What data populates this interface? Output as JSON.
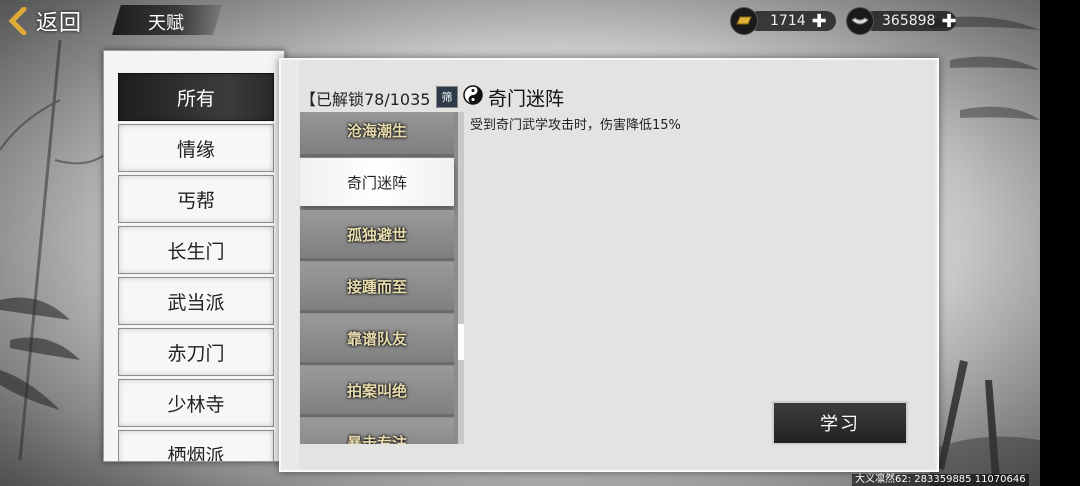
{
  "header": {
    "back_label": "返回",
    "page_title": "天赋",
    "gold": {
      "value": "1714",
      "icon": "gold-ingot-icon"
    },
    "silver": {
      "value": "365898",
      "icon": "silver-ingot-icon"
    }
  },
  "categories": [
    {
      "label": "所有",
      "active": true
    },
    {
      "label": "情缘"
    },
    {
      "label": "丐帮"
    },
    {
      "label": "长生门"
    },
    {
      "label": "武当派"
    },
    {
      "label": "赤刀门"
    },
    {
      "label": "少林寺"
    },
    {
      "label": "栖烟派"
    }
  ],
  "talents": {
    "unlock_status": "【已解锁78/1035",
    "filter_label": "筛",
    "items": [
      {
        "label": "沧海潮生"
      },
      {
        "label": "奇门迷阵",
        "active": true
      },
      {
        "label": "孤独避世"
      },
      {
        "label": "接踵而至"
      },
      {
        "label": "靠谱队友"
      },
      {
        "label": "拍案叫绝"
      },
      {
        "label": "暴击专注"
      }
    ],
    "selected": {
      "name": "奇门迷阵",
      "description": "受到奇门武学攻击时，伤害降低15%",
      "icon": "taiji-talent-icon"
    },
    "learn_label": "学习"
  },
  "footer_text": "大义凛然62: 283359885  11070646",
  "colors": {
    "active_tab": "#2a2a2a",
    "list_text": "#e8dcae",
    "button_bg": "#2d2d2d"
  }
}
